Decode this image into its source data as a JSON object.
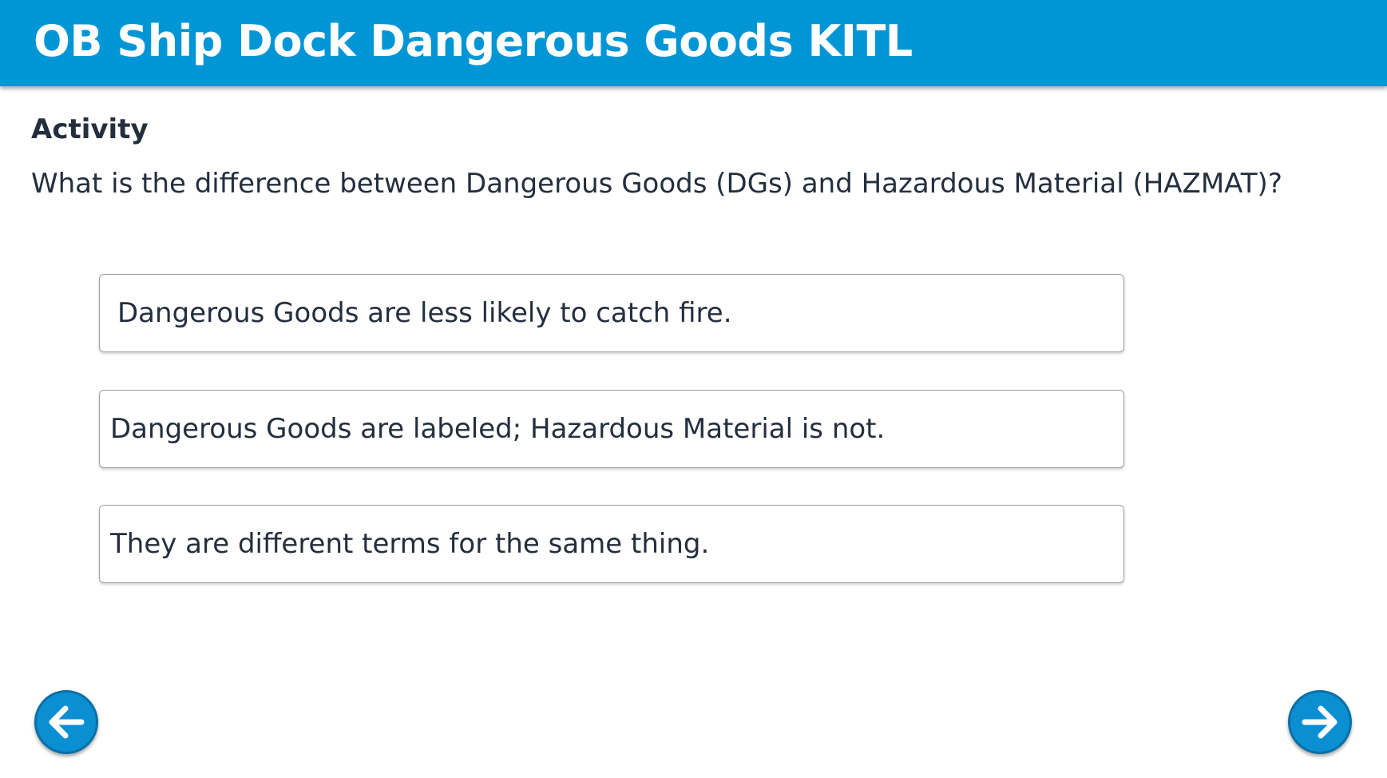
{
  "header": {
    "title": "OB Ship Dock Dangerous Goods KITL",
    "background_color": "#0096d6"
  },
  "activity": {
    "label": "Activity",
    "question": "What is the difference between Dangerous Goods (DGs) and Hazardous Material (HAZMAT)?",
    "options": [
      {
        "text": "Dangerous Goods are less likely to catch fire."
      },
      {
        "text": "Dangerous Goods are labeled; Hazardous Material is not."
      },
      {
        "text": "They are different terms for the same thing."
      }
    ]
  },
  "navigation": {
    "prev_icon": "arrow-left-icon",
    "next_icon": "arrow-right-icon",
    "button_color": "#0a8fd3"
  }
}
